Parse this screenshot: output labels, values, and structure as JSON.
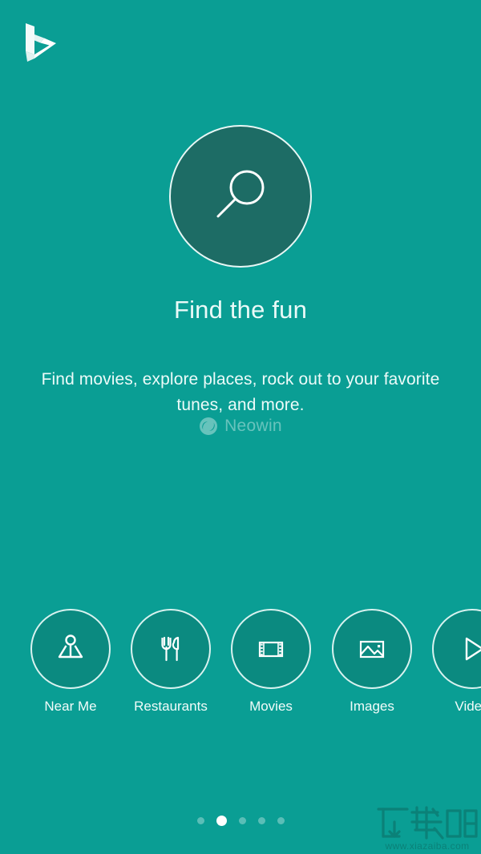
{
  "app": {
    "name": "Bing",
    "logo_icon": "bing-logo-icon",
    "background_color": "#0a9e94",
    "accent_color": "#1d6c65",
    "bubble_color": "#0b8a80",
    "text_color": "#ecfbf9"
  },
  "hero": {
    "icon": "search-magnifier-icon",
    "headline": "Find the fun",
    "subtitle": "Find movies, explore places, rock out to your favorite tunes, and more."
  },
  "watermark": {
    "neowin": {
      "icon": "neowin-logo-icon",
      "text": "Neowin"
    },
    "xiazaiba": {
      "logo_text": "下载吧",
      "url_text": "www.xiazaiba.com"
    }
  },
  "shortcuts": [
    {
      "label": "Near Me",
      "icon": "near-me-location-icon"
    },
    {
      "label": "Restaurants",
      "icon": "fork-knife-icon"
    },
    {
      "label": "Movies",
      "icon": "film-strip-icon"
    },
    {
      "label": "Images",
      "icon": "picture-mountain-icon"
    },
    {
      "label": "Video",
      "icon": "play-triangle-icon"
    }
  ],
  "pager": {
    "total": 5,
    "active_index": 1,
    "dots": [
      {
        "active": false
      },
      {
        "active": true
      },
      {
        "active": false
      },
      {
        "active": false
      },
      {
        "active": false
      }
    ]
  }
}
